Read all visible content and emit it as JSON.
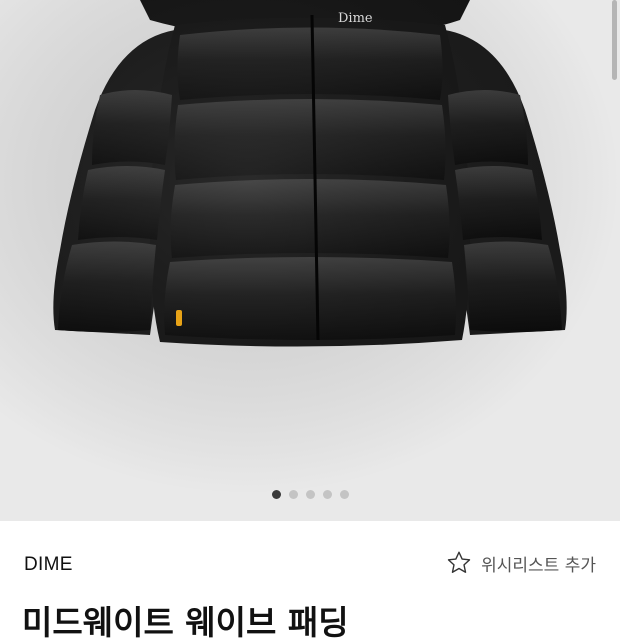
{
  "product": {
    "image_logo_text": "Dime",
    "image_count": 5,
    "active_image_index": 0,
    "brand": "DIME",
    "wishlist_label": "위시리스트 추가",
    "title": "미드웨이트 웨이브 패딩"
  },
  "colors": {
    "gallery_bg": "#e9e9e9",
    "dot_active": "#3a3a3a",
    "dot_inactive": "#c4c4c4",
    "text": "#111111"
  },
  "icons": {
    "wishlist": "star-outline-icon"
  }
}
